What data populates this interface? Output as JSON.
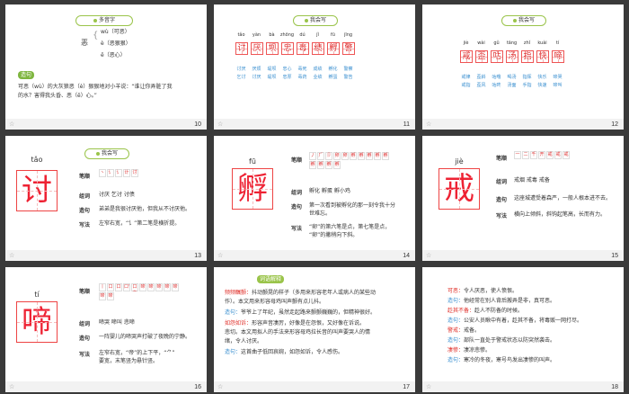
{
  "slides": [
    {
      "number": "10",
      "pill": "多音字",
      "char": "恶",
      "readings": [
        "wù（可恶）",
        "è（恶狠狠）",
        "ě（恶心）"
      ],
      "tag": "造句",
      "sentence_a": "可恶（wù）的大灰狼恶（è）狠狠地对小羊说：“谁让你弄脏了我",
      "sentence_b": "的水？害得我头昏、恶（ě）心。”"
    },
    {
      "number": "11",
      "pill": "我会写",
      "pinyin": [
        "tǎo",
        "yàn",
        "bà",
        "zhōng",
        "dú",
        "jǐ",
        "fū",
        "jīng"
      ],
      "chars": [
        "讨",
        "厌",
        "坝",
        "忠",
        "毒",
        "绩",
        "孵",
        "警"
      ],
      "words_row1": [
        "讨厌",
        "厌烦",
        "堤坝",
        "忠心",
        "毒死",
        "成绩",
        "孵化",
        "警察"
      ],
      "words_row2": [
        "乞讨",
        "讨厌",
        "堤坝",
        "忠厚",
        "毒药",
        "业绩",
        "孵蛋",
        "警告"
      ]
    },
    {
      "number": "12",
      "pill": "我会写",
      "pinyin": [
        "jiè",
        "wài",
        "gǔ",
        "tāng",
        "zhǐ",
        "kuài",
        "tí"
      ],
      "chars": [
        "戒",
        "歪",
        "咕",
        "汤",
        "指",
        "快",
        "啼"
      ],
      "words_row1": [
        "戒律",
        "歪斜",
        "咕噜",
        "喝汤",
        "指挥",
        "快乐",
        "啼哭"
      ],
      "words_row2": [
        "戒指",
        "歪风",
        "咕咚",
        "汤面",
        "手指",
        "快速",
        "啼叫"
      ]
    },
    {
      "number": "13",
      "pill": "我会写",
      "pinyin": "tǎo",
      "char": "讨",
      "labels": [
        "笔顺",
        "组词",
        "造句",
        "写法"
      ],
      "strokes": [
        "丶",
        "讠",
        "讠",
        "计",
        "讨"
      ],
      "words": "讨厌  乞讨  讨债",
      "sentence": "弟弟是我很讨厌他，但我从不讨厌他。",
      "method": "左窄右宽，“讠”第二笔是横折提。"
    },
    {
      "number": "14",
      "pinyin": "fū",
      "char": "孵",
      "labels": [
        "笔顺",
        "组词",
        "造句",
        "写法"
      ],
      "strokes": [
        "丿",
        "𠂆",
        "卩",
        "卵",
        "卵",
        "孵",
        "孵",
        "孵",
        "孵",
        "孵",
        "孵",
        "孵",
        "孵",
        "孵"
      ],
      "words": "孵化   孵蛋   孵小鸡",
      "sentence_a": "第一次看到被孵化的那一刻令我十分",
      "sentence_b": "世难忘。",
      "method_a": "“卵”的第六笔是点，第七笔是点，",
      "method_b": "“卵”的撇稍向下斜。"
    },
    {
      "number": "15",
      "pinyin": "jiè",
      "char": "戒",
      "labels": [
        "笔顺",
        "组词",
        "造句",
        "写法"
      ],
      "strokes": [
        "一",
        "二",
        "千",
        "开",
        "戒",
        "戒",
        "戒"
      ],
      "words": "戒烟    戒毒    戒备",
      "sentence": "这座城遭受着森严，一般人根本进不去。",
      "method": "横向上倾斜，斜钩起笔高，长而有力。"
    },
    {
      "number": "16",
      "pinyin": "tí",
      "char": "啼",
      "labels": [
        "笔顺",
        "组词",
        "造句",
        "写法"
      ],
      "strokes": [
        "丨",
        "口",
        "口",
        "口'",
        "口亠",
        "啼",
        "啼",
        "啼",
        "啼",
        "啼",
        "啼",
        "啼"
      ],
      "words": "啼哭   啼叫   悲啼",
      "sentence": "一阵婴儿的啼哭声打破了夜晚的宁静。",
      "method_a": "左窄右宽，“帝”的上下平，“⺈”",
      "method_b": "要宽，末笔竖为悬针竖。"
    },
    {
      "number": "17",
      "tag": "词语解释",
      "entries": [
        {
          "head": "频频瞩颤：",
          "text": "抖动颤晃的样子（多用来形容老年人或病人的某些动"
        },
        {
          "head": "",
          "text": "作）。本文用来形容母鸡叫声颤有点儿抖。"
        },
        {
          "head": "造句：",
          "text": "爷爷上了年纪，虽然走起路来颤颤巍巍的，但精神很好。"
        },
        {
          "head": "如怨如诉：",
          "text": "形容声音凄厉，好像是在怨恨，又好像在诉说。"
        },
        {
          "head": "",
          "text": "悲切。本文用拟人的手法来形容母鸡拉长音的叫声要哭人的情"
        },
        {
          "head": "",
          "text": "绪，令人讨厌。"
        },
        {
          "head": "造句：",
          "text": "这首曲子低回哀婉，如怨如诉，令人感伤。"
        }
      ]
    },
    {
      "number": "18",
      "entries": [
        {
          "head": "可恶：",
          "text": "令人厌恶，使人愤恨。"
        },
        {
          "head": "造句：",
          "text": "他经常在别人背后搬弄是非，真可恶。"
        },
        {
          "head": "趁其不备：",
          "text": "趁人不防备的时候。"
        },
        {
          "head": "造句：",
          "text": "公安人员瞅中有着，趁其不备，将毒贩一网打尽。"
        },
        {
          "head": "警戒：",
          "text": "戒备。"
        },
        {
          "head": "造句：",
          "text": "部队一直处于警戒状态以防突然袭击。"
        },
        {
          "head": "凄惨：",
          "text": "凄凉悲惨。"
        },
        {
          "head": "造句：",
          "text": "寒冷的冬夜，寒号鸟发出凄惨的叫声。"
        }
      ]
    }
  ]
}
